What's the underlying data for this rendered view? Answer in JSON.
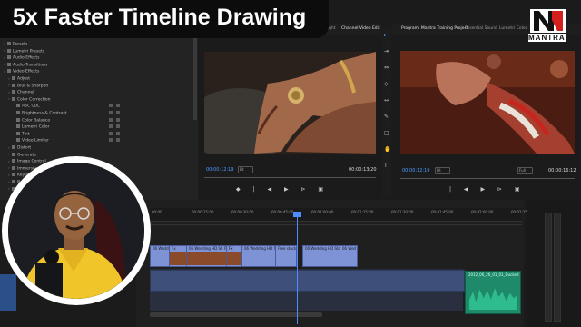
{
  "banner": {
    "title": "5x Faster Timeline Drawing"
  },
  "logo": {
    "brand": "MANTRA"
  },
  "effects_panel": {
    "items": [
      {
        "label": "Presets",
        "level": 0
      },
      {
        "label": "Lumetri Presets",
        "level": 0
      },
      {
        "label": "Audio Effects",
        "level": 0
      },
      {
        "label": "Audio Transitions",
        "level": 0
      },
      {
        "label": "Video Effects",
        "level": 0
      },
      {
        "label": "Adjust",
        "level": 1
      },
      {
        "label": "Blur & Sharpen",
        "level": 1
      },
      {
        "label": "Channel",
        "level": 1
      },
      {
        "label": "Color Correction",
        "level": 1
      },
      {
        "label": "ASC CDL",
        "level": 2
      },
      {
        "label": "Brightness & Contrast",
        "level": 2
      },
      {
        "label": "Color Balance",
        "level": 2
      },
      {
        "label": "Lumetri Color",
        "level": 2
      },
      {
        "label": "Tint",
        "level": 2
      },
      {
        "label": "Video Limiter",
        "level": 2
      },
      {
        "label": "Distort",
        "level": 1
      },
      {
        "label": "Generate",
        "level": 1
      },
      {
        "label": "Image Control",
        "level": 1
      },
      {
        "label": "Immersive Video",
        "level": 1
      },
      {
        "label": "Keying",
        "level": 1
      },
      {
        "label": "Noise & Grain",
        "level": 1
      },
      {
        "label": "Obsolete",
        "level": 1
      }
    ]
  },
  "source_monitor": {
    "tabs": [
      "aight",
      "Channel Video Edit"
    ],
    "timecode_in": "00:00:12:19",
    "fit": "Fit",
    "timecode_out": "00:00:13:20"
  },
  "program_monitor": {
    "tabs": [
      "Program: Mantra Training Project",
      "Essential Sound",
      "Lumetri Color"
    ],
    "timecode_in": "00:00:12:19",
    "fit": "Fit",
    "quality": "Full",
    "timecode_out": "00:00:16:12"
  },
  "timeline": {
    "ruler": [
      "00:00",
      "00:00:15:00",
      "00:00:30:00",
      "00:00:45:00",
      "00:01:00:00",
      "00:01:15:00",
      "00:01:30:00",
      "00:01:45:00",
      "00:02:00:00",
      "00:02:15:00"
    ],
    "clips": [
      {
        "label": "06 Wedding HD Stock Vid"
      },
      {
        "label": "Fx"
      },
      {
        "label": "06 Wedding HD Stock Video"
      },
      {
        "label": "Fx"
      },
      {
        "label": "Fx"
      },
      {
        "label": "06 Wedding HD Stock Video"
      },
      {
        "label": "Free stock footage"
      },
      {
        "label": "06 Wedding HD Stock Video"
      },
      {
        "label": "06 Wed"
      }
    ],
    "audio_clip": "2012_06_26_01_01_Ducked"
  }
}
